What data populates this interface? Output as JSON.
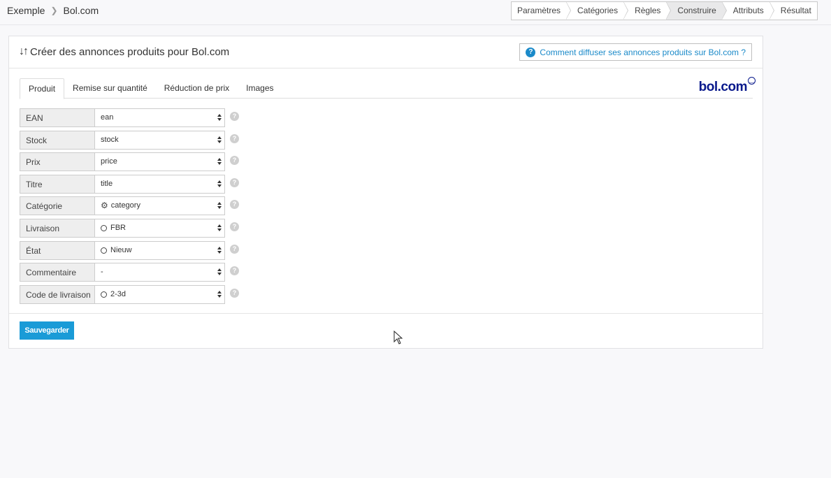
{
  "breadcrumb": {
    "parent": "Exemple",
    "current": "Bol.com"
  },
  "steps": [
    "Paramètres",
    "Catégories",
    "Règles",
    "Construire",
    "Attributs",
    "Résultat"
  ],
  "active_step": "Construire",
  "panel": {
    "title": "Créer des annonces produits pour Bol.com",
    "help_link": "Comment diffuser ses annonces produits sur Bol.com ?"
  },
  "tabs": [
    "Produit",
    "Remise sur quantité",
    "Réduction de prix",
    "Images"
  ],
  "active_tab": "Produit",
  "logo_text": "bol.com",
  "fields": [
    {
      "label": "EAN",
      "value": "ean",
      "icon": "none"
    },
    {
      "label": "Stock",
      "value": "stock",
      "icon": "none"
    },
    {
      "label": "Prix",
      "value": "price",
      "icon": "none"
    },
    {
      "label": "Titre",
      "value": "title",
      "icon": "none"
    },
    {
      "label": "Catégorie",
      "value": "category",
      "icon": "gear-icon"
    },
    {
      "label": "Livraison",
      "value": "FBR",
      "icon": "circle-icon"
    },
    {
      "label": "État",
      "value": "Nieuw",
      "icon": "circle-icon"
    },
    {
      "label": "Commentaire",
      "value": "-",
      "icon": "none"
    },
    {
      "label": "Code de livraison",
      "value": "2-3d",
      "icon": "circle-icon"
    }
  ],
  "save_label": "Sauvegarder",
  "colors": {
    "accent": "#1a9bd7",
    "link": "#1b8ac9",
    "logo": "#0a1a8c"
  }
}
